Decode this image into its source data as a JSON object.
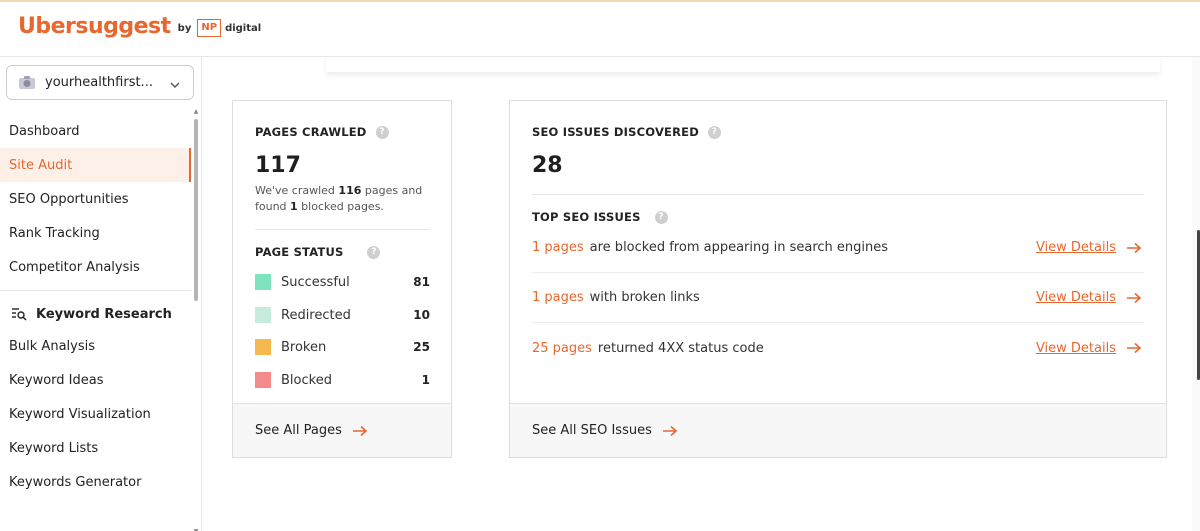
{
  "header": {
    "logo_text": "Ubersuggest",
    "by": "by",
    "np": "NP",
    "digital": "digital"
  },
  "sidebar": {
    "project_name": "yourhealthfirst...",
    "items": [
      {
        "label": "Dashboard"
      },
      {
        "label": "Site Audit"
      },
      {
        "label": "SEO Opportunities"
      },
      {
        "label": "Rank Tracking"
      },
      {
        "label": "Competitor Analysis"
      }
    ],
    "section_label": "Keyword Research",
    "kw_items": [
      {
        "label": "Bulk Analysis"
      },
      {
        "label": "Keyword Ideas"
      },
      {
        "label": "Keyword Visualization"
      },
      {
        "label": "Keyword Lists"
      },
      {
        "label": "Keywords Generator"
      }
    ]
  },
  "pages_card": {
    "title": "PAGES CRAWLED",
    "help": "?",
    "count": "117",
    "desc_1": "We've crawled ",
    "desc_num1": "116",
    "desc_2": " pages and",
    "desc_3": "found ",
    "desc_num2": "1",
    "desc_4": " blocked pages.",
    "status_title": "PAGE STATUS",
    "statuses": [
      {
        "label": "Successful",
        "value": "81",
        "color": "#7fe3c0"
      },
      {
        "label": "Redirected",
        "value": "10",
        "color": "#c5ecdd"
      },
      {
        "label": "Broken",
        "value": "25",
        "color": "#f5b94f"
      },
      {
        "label": "Blocked",
        "value": "1",
        "color": "#f58a8a"
      }
    ],
    "footer": "See All Pages"
  },
  "seo_card": {
    "title": "SEO ISSUES DISCOVERED",
    "help": "?",
    "count": "28",
    "top_title": "TOP SEO ISSUES",
    "issues": [
      {
        "count": "1 pages",
        "text": "are blocked from appearing in search engines",
        "link": "View Details"
      },
      {
        "count": "1 pages",
        "text": "with broken links",
        "link": "View Details"
      },
      {
        "count": "25 pages",
        "text": "returned 4XX status code",
        "link": "View Details"
      }
    ],
    "footer": "See All SEO Issues"
  },
  "colors": {
    "accent": "#e8672e"
  }
}
